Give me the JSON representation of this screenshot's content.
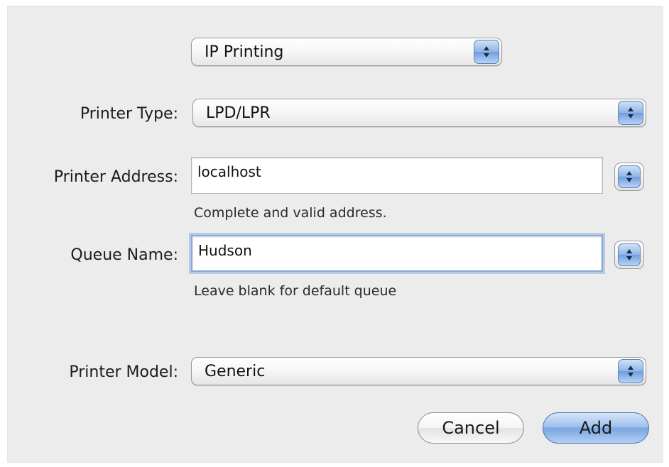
{
  "connection_type": {
    "value": "IP Printing"
  },
  "printer_type": {
    "label": "Printer Type:",
    "value": "LPD/LPR"
  },
  "printer_address": {
    "label": "Printer Address:",
    "value": "localhost",
    "hint": "Complete and valid address."
  },
  "queue_name": {
    "label": "Queue Name:",
    "value": "Hudson",
    "hint": "Leave blank for default queue"
  },
  "printer_model": {
    "label": "Printer Model:",
    "value": "Generic"
  },
  "buttons": {
    "cancel": "Cancel",
    "add": "Add"
  },
  "icons": {
    "popup_arrows": "up-down-arrows-icon"
  },
  "colors": {
    "accent": "#7aa6e0",
    "focus_ring": "#86a9d8",
    "background": "#ececec"
  }
}
